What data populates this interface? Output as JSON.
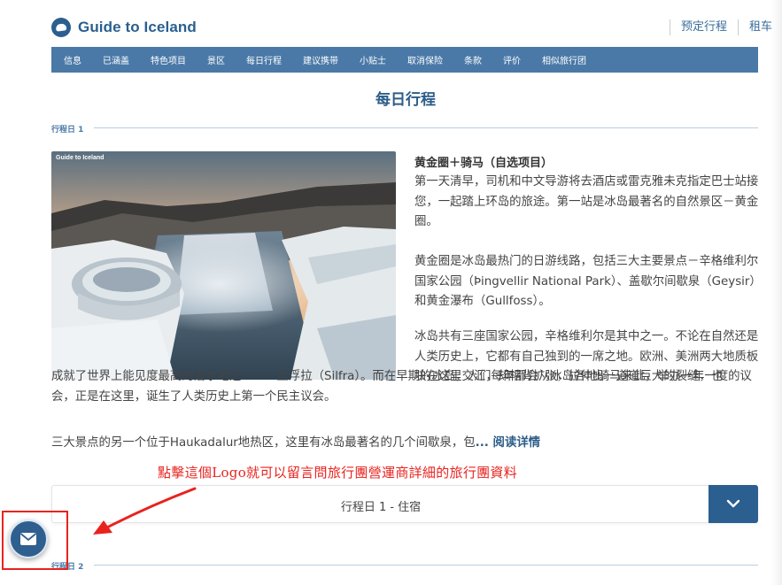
{
  "header": {
    "logo_text": "Guide to Iceland",
    "links": [
      "预定行程",
      "租车"
    ]
  },
  "nav": {
    "items": [
      "信息",
      "已涵盖",
      "特色项目",
      "景区",
      "每日行程",
      "建议携带",
      "小贴士",
      "取消保险",
      "条款",
      "评价",
      "相似旅行团"
    ]
  },
  "section": {
    "title": "每日行程"
  },
  "day1": {
    "label": "行程日 1",
    "photo_caption": "Guide to Iceland",
    "tour_title": "黄金圈＋骑马（自选项目）",
    "para1": "第一天清早，司机和中文导游将去酒店或雷克雅未克指定巴士站接您，一起踏上环岛的旅途。第一站是冰岛最著名的自然景区－黄金圈。",
    "para2": "黄金圈是冰岛最热门的日游线路，包括三大主要景点－辛格维利尔国家公园（Þingvellir National Park）、盖歇尔间歇泉（Geysir）和黄金瀑布（Gullfoss）。",
    "para3a": "冰岛共有三座国家公园，辛格维利尔是其中之一。不论在自然还是人类历史上，它都有自己独到的一席之地。欧洲、美洲两大地质板块在这里交汇，却相背扩张，拉伸出一道道巨大的裂缝，也",
    "para3b": "成就了世界上能见度最高的潜水地之一－－丝浮拉（Silfra）。而在早期的冰岛，人们每年都会从冰岛各地骑马来此，举办一年一度的议会，正是在这里，诞生了人类历史上第一个民主议会。",
    "para4": "三大景点的另一个位于Haukadalur地热区，这里有冰岛最著名的几个间歇泉，包",
    "read_more": "... 阅读详情",
    "accordion_label": "行程日 1 - 住宿"
  },
  "annotation": {
    "text": "點擊這個Logo就可以留言問旅行團營運商詳細的旅行團資料"
  },
  "day2": {
    "label": "行程日 2"
  },
  "colors": {
    "brand": "#2a5f8f",
    "nav_bg": "#4a79a7",
    "annotation_red": "#e8231f"
  },
  "icons": {
    "logo": "iceland-logo-icon",
    "accordion": "chevron-down-icon",
    "mail": "mail-icon"
  }
}
